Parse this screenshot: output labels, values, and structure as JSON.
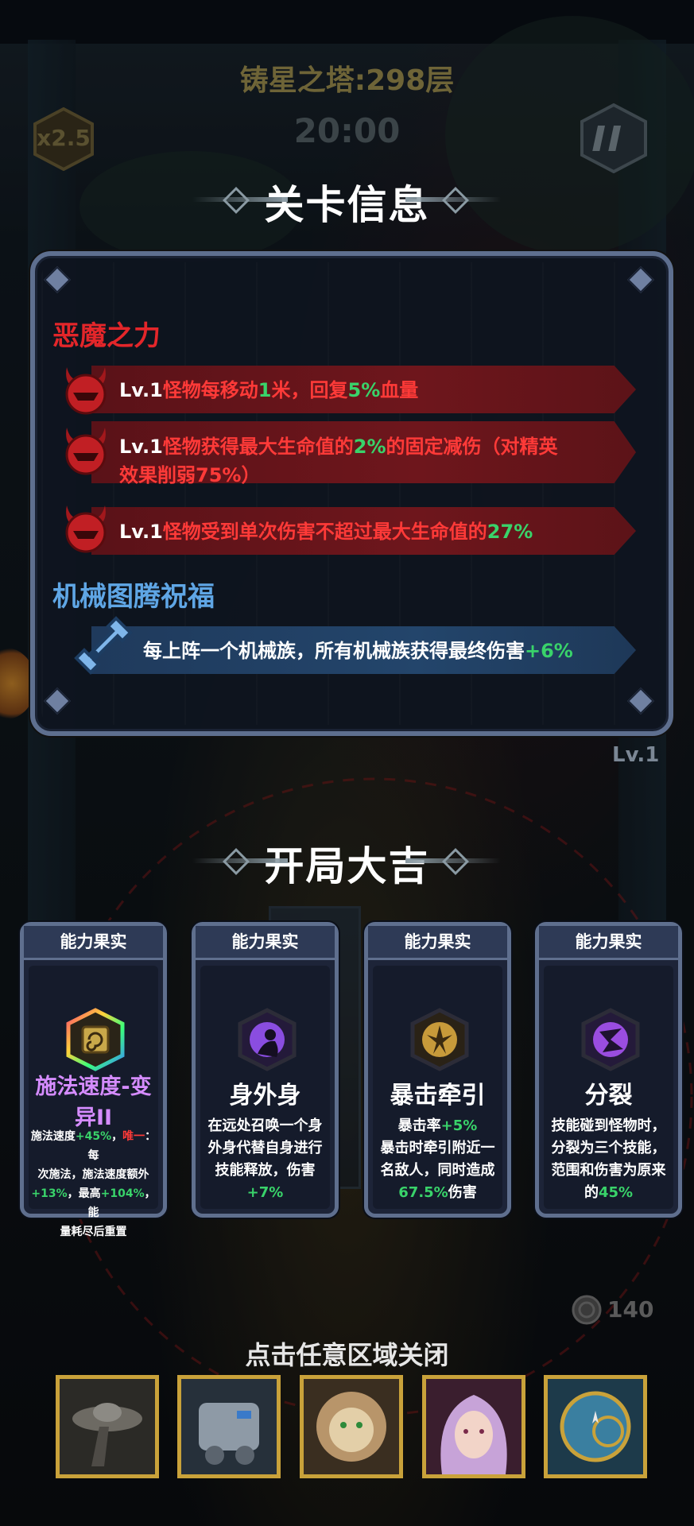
{
  "hud": {
    "tower_title": "铸星之塔:298层",
    "timer": "20:00",
    "speed_label": "x2.5"
  },
  "stage_info": {
    "heading": "关卡信息",
    "demon_power": {
      "title": "恶魔之力",
      "items": [
        {
          "lv": "Lv.1",
          "parts": [
            {
              "t": "怪物每移动",
              "c": "red"
            },
            {
              "t": "1",
              "c": "grn"
            },
            {
              "t": "米，回复",
              "c": "red"
            },
            {
              "t": "5%",
              "c": "grn"
            },
            {
              "t": "血量",
              "c": "red"
            }
          ]
        },
        {
          "lv": "Lv.1",
          "parts": [
            {
              "t": "怪物获得最大生命值的",
              "c": "red"
            },
            {
              "t": "2%",
              "c": "grn"
            },
            {
              "t": "的固定减伤（对精英",
              "c": "red"
            }
          ],
          "line2": "效果削弱75%）"
        },
        {
          "lv": "Lv.1",
          "parts": [
            {
              "t": "怪物受到单次伤害不超过最大生命值的",
              "c": "red"
            },
            {
              "t": "27%",
              "c": "grn"
            }
          ]
        }
      ]
    },
    "mech_blessing": {
      "title": "机械图腾祝福",
      "text": "每上阵一个机械族，所有机械族获得最终伤害",
      "bonus": "+6%"
    }
  },
  "level_tag": "Lv.1",
  "lucky_start": {
    "heading": "开局大吉",
    "cards": [
      {
        "header": "能力果实",
        "name": "施法速度-变异II",
        "name_l1": "施法速度-变",
        "name_l2": "异II",
        "desc": [
          [
            {
              "t": "施法速度",
              "c": "wht"
            },
            {
              "t": "+45%",
              "c": "grn"
            },
            {
              "t": "，",
              "c": "wht"
            },
            {
              "t": "唯一",
              "c": "red"
            },
            {
              "t": "：每",
              "c": "wht"
            }
          ],
          [
            {
              "t": "次施法，施法速度额外",
              "c": "wht"
            }
          ],
          [
            {
              "t": "+13%",
              "c": "grn"
            },
            {
              "t": "，最高",
              "c": "wht"
            },
            {
              "t": "+104%",
              "c": "grn"
            },
            {
              "t": "，能",
              "c": "wht"
            }
          ],
          [
            {
              "t": "量耗尽后重置",
              "c": "wht"
            }
          ]
        ]
      },
      {
        "header": "能力果实",
        "name": "身外身",
        "desc": [
          [
            {
              "t": "在远处召唤一个身",
              "c": "wht"
            }
          ],
          [
            {
              "t": "外身代替自身进行",
              "c": "wht"
            }
          ],
          [
            {
              "t": "技能释放，伤害",
              "c": "wht"
            }
          ],
          [
            {
              "t": "+7%",
              "c": "grn"
            }
          ]
        ]
      },
      {
        "header": "能力果实",
        "name": "暴击牵引",
        "desc": [
          [
            {
              "t": "暴击率",
              "c": "wht"
            },
            {
              "t": "+5%",
              "c": "grn"
            }
          ],
          [
            {
              "t": "暴击时牵引附近一",
              "c": "wht"
            }
          ],
          [
            {
              "t": "名敌人，同时造成",
              "c": "wht"
            }
          ],
          [
            {
              "t": "67.5%",
              "c": "grn"
            },
            {
              "t": "伤害",
              "c": "wht"
            }
          ]
        ]
      },
      {
        "header": "能力果实",
        "name": "分裂",
        "desc": [
          [
            {
              "t": "技能碰到怪物时，",
              "c": "wht"
            }
          ],
          [
            {
              "t": "分裂为三个技能，",
              "c": "wht"
            }
          ],
          [
            {
              "t": "范围和伤害为原来",
              "c": "wht"
            }
          ],
          [
            {
              "t": "的",
              "c": "wht"
            },
            {
              "t": "45%",
              "c": "grn"
            }
          ]
        ]
      }
    ]
  },
  "coins": "140",
  "close_hint": "点击任意区域关闭",
  "hero_slots": [
    "ufo-hero-portrait",
    "mech-hero-portrait",
    "lion-hero-portrait",
    "sorceress-hero-portrait",
    "clockwork-hero-portrait"
  ],
  "colors": {
    "red": "#ff3a38",
    "green": "#39d36a",
    "mech_blue": "#5fa6e5",
    "frame": "#5e6f8f",
    "gold": "#c9a23a"
  }
}
